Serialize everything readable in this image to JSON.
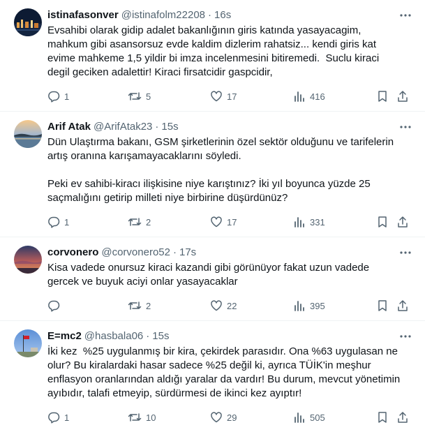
{
  "tweets": [
    {
      "name": "istinafasonver",
      "handle": "@istinafolm22208",
      "time": "16s",
      "text": "Evsahibi olarak gidip adalet bakanlığının giris katında yasayacagim,\nmahkum gibi asansorsuz evde kaldim dizlerim rahatsiz... kendi giris kat\nevime mahkeme 1,5 yildir bi imza incelenmesini bitiremedi.  Suclu kiraci\ndegil geciken adalettir! Kiraci firsatcidir gaspcidir,",
      "replies": "1",
      "retweets": "5",
      "likes": "17",
      "views": "416",
      "avatar": "city-night"
    },
    {
      "name": "Arif Atak",
      "handle": "@ArifAtak23",
      "time": "15s",
      "text": "Dün Ulaştırma bakanı, GSM şirketlerinin özel sektör olduğunu ve tarifelerin\nartış oranına karışamayacaklarını söyledi.\n\nPeki ev sahibi-kiracı ilişkisine niye karıştınız? İki yıl boyunca yüzde 25\nsaçmalığını getirip milleti niye birbirine düşürdünüz?",
      "replies": "1",
      "retweets": "2",
      "likes": "17",
      "views": "331",
      "avatar": "lake-sunset"
    },
    {
      "name": "corvonero",
      "handle": "@corvonero52",
      "time": "17s",
      "text": "Kisa vadede onursuz kiraci kazandi gibi görünüyor fakat uzun vadede\ngercek ve buyuk aciyi onlar yasayacaklar",
      "replies": "",
      "retweets": "2",
      "likes": "22",
      "views": "395",
      "avatar": "dusk-sky"
    },
    {
      "name": "E=mc2",
      "handle": "@hasbala06",
      "time": "15s",
      "text": "İki kez  %25 uygulanmış bir kira, çekirdek parasıdır. Ona %63 uygulasan ne\nolur? Bu kiralardaki hasar sadece %25 değil ki, ayrıca TÜİK'in meşhur\nenflasyon oranlarından aldığı yaralar da vardır! Bu durum, mevcut yönetimin\nayıbıdır, talafi etmeyip, sürdürmesi de ikinci kez ayıptır!",
      "replies": "1",
      "retweets": "10",
      "likes": "29",
      "views": "505",
      "avatar": "flag-sky"
    }
  ],
  "colors": {
    "text": "#0f1419",
    "muted": "#536471",
    "divider": "#eff3f4"
  }
}
